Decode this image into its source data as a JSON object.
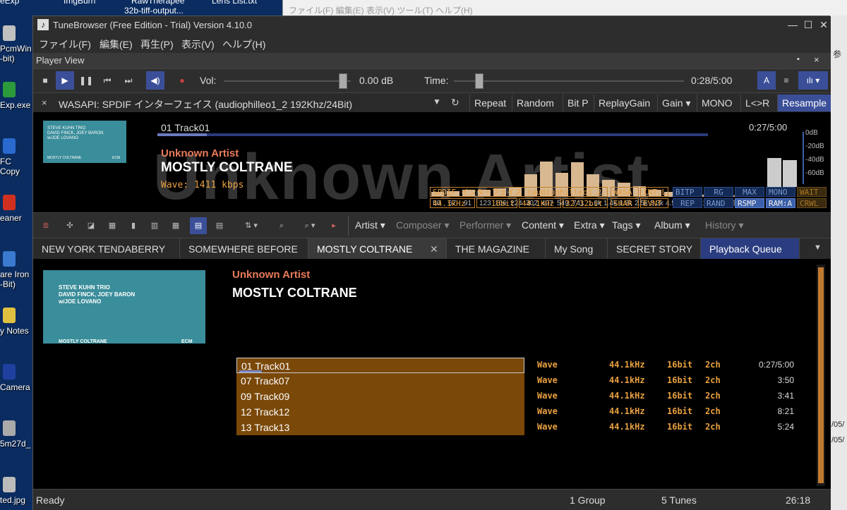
{
  "desktop": {
    "top_labels": [
      "eExp",
      "ImgBurn",
      "RawTherapee",
      "32b-tiff-output...",
      "Lens List.txt"
    ],
    "icons": [
      {
        "label": "PcmWin\n-bit)",
        "color": "#c0c0c0"
      },
      {
        "label": "Exp.exe",
        "color": "#2a9a3a"
      },
      {
        "label": "FC\nCopy",
        "color": "#2a6ad0"
      },
      {
        "label": "eaner",
        "color": "#d03020"
      },
      {
        "label": "are Iron\n-Bit)",
        "color": "#3a7ad0"
      },
      {
        "label": "y Notes",
        "color": "#e0c040"
      },
      {
        "label": "Camera",
        "color": "#2040a0"
      },
      {
        "label": "5m27d_",
        "color": "#aaaaaa"
      },
      {
        "label": "ted.jpg",
        "color": "#bbbbbb"
      }
    ]
  },
  "bg_window": {
    "menu": "ファイル(F)  編集(E)  表示(V)  ツール(T)  ヘルプ(H)",
    "right_top": "参",
    "right_a": "/05/",
    "right_b": "/05/"
  },
  "window": {
    "title": "TuneBrowser (Free Edition - Trial) Version 4.10.0",
    "min": "—",
    "max": "☐",
    "close": "✕"
  },
  "menu": [
    "ファイル(F)",
    "編集(E)",
    "再生(P)",
    "表示(V)",
    "ヘルプ(H)"
  ],
  "player_view": {
    "title": "Player View",
    "pin": "▪",
    "close": "×"
  },
  "transport": {
    "stop": "■",
    "play": "▶",
    "pause": "❚❚",
    "prev": "⏮",
    "next": "⏭",
    "mute": "◀)",
    "rec": "●",
    "vol_label": "Vol:",
    "vol_value": "0.00 dB",
    "time_label": "Time:",
    "time_value": "0:28/5:00",
    "right_a": "A",
    "right_b": "≡",
    "right_c": "ılı ▾",
    "volume_level": 0.97,
    "time_fraction": 0.093
  },
  "output": {
    "close": "×",
    "device": "WASAPI: SPDIF インターフェイス (audiophilleo1_2 192Khz/24Bit)",
    "dropdown": "▼",
    "refresh": "↻",
    "buttons": [
      "Repeat",
      "Random",
      "Bit P",
      "ReplayGain",
      "Gain ▾",
      "MONO",
      "L<>R",
      "Resample"
    ]
  },
  "now_playing": {
    "track": "01 Track01",
    "time": "0:27/5:00",
    "artist": "Unknown Artist",
    "album": "MOSTLY COLTRANE",
    "format": "Wave: 1411 kbps",
    "watermark": "Unknown Artist",
    "progress": 0.09,
    "art": {
      "line1": "STEVE KUHN TRIO",
      "line2": "DAVID FINCK, JOEY BARON",
      "line3": "w/JOE LOVANO",
      "line4": "MOSTLY COLTRANE",
      "line5": "ECM"
    }
  },
  "spectrum": {
    "labels": [
      "50",
      "67",
      "91",
      "123",
      "166",
      "224",
      "302",
      "407",
      "549",
      "741",
      "1.0k",
      "1.4k",
      "1.8k",
      "2.5k",
      "3.3k",
      "4.5k",
      "6.0k",
      "8.1k",
      "11k",
      "15k",
      "20k"
    ],
    "levels": [
      0.08,
      0.1,
      0.12,
      0.12,
      0.14,
      0.15,
      0.38,
      0.6,
      0.4,
      0.58,
      0.38,
      0.28,
      0.24,
      0.18,
      0.12,
      0.08,
      0.05,
      0.04,
      0.03,
      0.02,
      0.02
    ],
    "vu_levels": [
      0.62,
      0.58
    ],
    "vu_labels": [
      "L",
      "R"
    ],
    "db_labels": [
      "0dB",
      "-20dB",
      "-40dB",
      "-60dB"
    ]
  },
  "status_boxes": {
    "spdif": "SPDIF インターフェイス (audiophilleo1_2...",
    "rate1": "44.1kHz",
    "bits1": "16bit",
    "rate2": "44.1kHz",
    "bits2": "32/32bit",
    "wasa": "WASA",
    "intl": "INT:L",
    "shar": "SHAR",
    "evnt": "EVNT",
    "flags1": [
      "BITP",
      "RG",
      "MAX",
      "MONO"
    ],
    "flags2": [
      "REP",
      "RAND",
      "RSMP",
      "RAM:A"
    ],
    "wait": "WAIT",
    "crwl": "CRWL"
  },
  "toolbar": {
    "icons": [
      "≣",
      "✣",
      "◪",
      "▦",
      "▮",
      "▥",
      "▦",
      "▤",
      "▤",
      "⇅ ▾",
      "⌕",
      "⌕ ▾",
      "▸"
    ],
    "columns": [
      "Artist ▾",
      "Composer ▾",
      "Performer ▾",
      "Content ▾",
      "Extra ▾",
      "Tags ▾",
      "Album ▾",
      "History ▾"
    ],
    "column_colors": [
      "#dddddd",
      "#888888",
      "#888888",
      "#dddddd",
      "#dddddd",
      "#dddddd",
      "#dddddd",
      "#888888"
    ]
  },
  "tabs": [
    "NEW YORK TENDABERRY",
    "SOMEWHERE BEFORE",
    "MOSTLY COLTRANE",
    "THE MAGAZINE",
    "My Song",
    "SECRET STORY",
    "Playback Queue"
  ],
  "tab_close": "✕",
  "tab_menu": "▼",
  "album_view": {
    "artist": "Unknown Artist",
    "album": "MOSTLY COLTRANE"
  },
  "tracks": [
    {
      "name": "01 Track01",
      "fmt": "Wave",
      "rate": "44.1kHz",
      "bits": "16bit",
      "ch": "2ch",
      "len": "0:27/5:00"
    },
    {
      "name": "07 Track07",
      "fmt": "Wave",
      "rate": "44.1kHz",
      "bits": "16bit",
      "ch": "2ch",
      "len": "3:50"
    },
    {
      "name": "09 Track09",
      "fmt": "Wave",
      "rate": "44.1kHz",
      "bits": "16bit",
      "ch": "2ch",
      "len": "3:41"
    },
    {
      "name": "12 Track12",
      "fmt": "Wave",
      "rate": "44.1kHz",
      "bits": "16bit",
      "ch": "2ch",
      "len": "8:21"
    },
    {
      "name": "13 Track13",
      "fmt": "Wave",
      "rate": "44.1kHz",
      "bits": "16bit",
      "ch": "2ch",
      "len": "5:24"
    }
  ],
  "status": {
    "ready": "Ready",
    "groups": "1 Group",
    "tunes": "5 Tunes",
    "time": "26:18"
  }
}
